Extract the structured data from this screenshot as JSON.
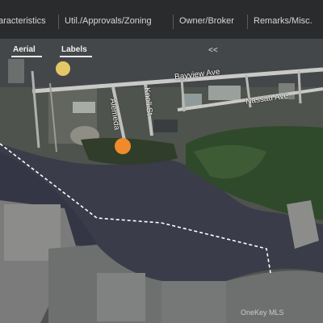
{
  "tabs": [
    {
      "label": "aracteristics"
    },
    {
      "label": "Util./Approvals/Zoning"
    },
    {
      "label": "Owner/Broker"
    },
    {
      "label": "Remarks/Misc."
    }
  ],
  "map": {
    "controls": {
      "aerial": "Aerial",
      "labels": "Labels",
      "collapse": "<<"
    },
    "roads": {
      "bayview": "Bayview Ave",
      "nassau": "Nassau Ave",
      "alemeda": "Alemeda",
      "knoll": "Knoll St"
    },
    "attribution": "OneKey MLS",
    "colors": {
      "water": "#3a3c4a",
      "land": "#5a5f58",
      "vegetation": "#2f4a2a",
      "marker": "#f08a2a",
      "boundary": "#ffffff"
    }
  }
}
